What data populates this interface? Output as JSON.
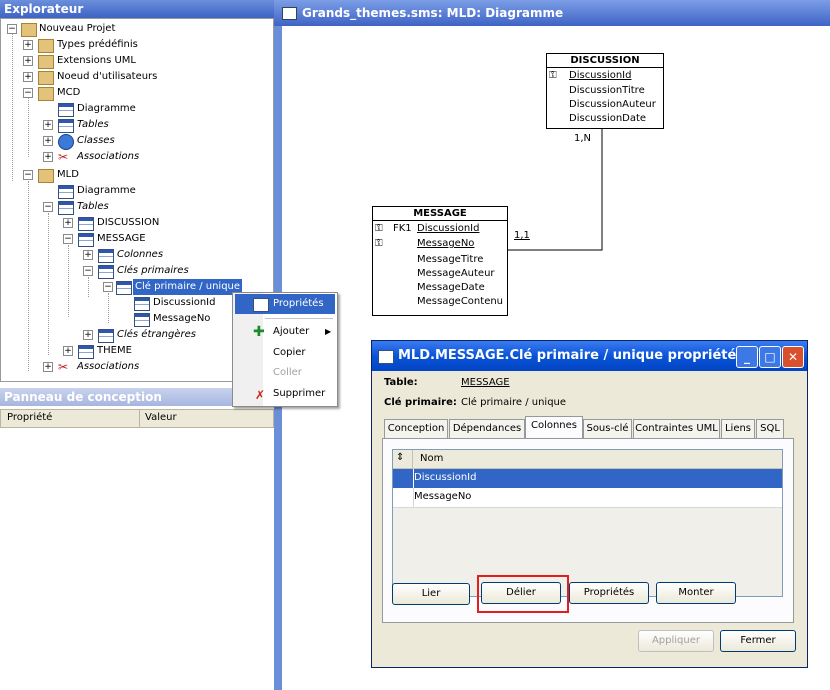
{
  "explorer": {
    "title": "Explorateur",
    "tree": [
      {
        "label": "Nouveau Projet",
        "icon": "project-icon"
      },
      {
        "label": "Types prédéfinis",
        "icon": "types-folder-icon"
      },
      {
        "label": "Extensions UML",
        "icon": "uml-extensions-icon"
      },
      {
        "label": "Noeud d'utilisateurs",
        "icon": "user-node-icon"
      },
      {
        "label": "MCD",
        "icon": "mcd-folder-icon"
      },
      {
        "label": "Diagramme",
        "icon": "diagram-icon"
      },
      {
        "label": "Tables",
        "icon": "tables-icon"
      },
      {
        "label": "Classes",
        "icon": "classes-icon"
      },
      {
        "label": "Associations",
        "icon": "associations-icon"
      },
      {
        "label": "MLD",
        "icon": "mld-folder-icon"
      },
      {
        "label": "Diagramme",
        "icon": "diagram-icon"
      },
      {
        "label": "Tables",
        "icon": "tables-icon"
      },
      {
        "label": "DISCUSSION",
        "icon": "table-icon"
      },
      {
        "label": "MESSAGE",
        "icon": "table-icon"
      },
      {
        "label": "Colonnes",
        "icon": "columns-icon"
      },
      {
        "label": "Clés primaires",
        "icon": "primary-keys-icon"
      },
      {
        "label": "Clé primaire / unique",
        "icon": "primary-key-icon"
      },
      {
        "label": "DiscussionId",
        "icon": "column-icon"
      },
      {
        "label": "MessageNo",
        "icon": "column-icon"
      },
      {
        "label": "Clés étrangères",
        "icon": "foreign-keys-icon"
      },
      {
        "label": "THEME",
        "icon": "table-icon"
      },
      {
        "label": "Associations",
        "icon": "associations-icon"
      }
    ]
  },
  "panneau": {
    "title": "Panneau de conception",
    "col_property": "Propriété",
    "col_value": "Valeur"
  },
  "context_menu": {
    "items": [
      {
        "label": "Propriétés",
        "icon": "properties-icon"
      },
      {
        "label": "Ajouter",
        "icon": "add-icon"
      },
      {
        "label": "Copier",
        "icon": ""
      },
      {
        "label": "Coller",
        "icon": ""
      },
      {
        "label": "Supprimer",
        "icon": "delete-icon"
      }
    ]
  },
  "diagram": {
    "title": "Grands_themes.sms: MLD: Diagramme",
    "discussion": {
      "name": "DISCUSSION",
      "attrs": [
        "DiscussionId",
        "DiscussionTitre",
        "DiscussionAuteur",
        "DiscussionDate"
      ]
    },
    "message": {
      "name": "MESSAGE",
      "fk": "FK1",
      "attrs": [
        "DiscussionId",
        "MessageNo",
        "MessageTitre",
        "MessageAuteur",
        "MessageDate",
        "MessageContenu"
      ]
    },
    "card_top": "1,N",
    "card_bottom": "1,1"
  },
  "dialog": {
    "title": "MLD.MESSAGE.Clé primaire / unique propriétés",
    "table_label": "Table:",
    "table_value": "MESSAGE",
    "pk_label": "Clé primaire:",
    "pk_value": "Clé primaire / unique",
    "tabs": [
      "Conception",
      "Dépendances",
      "Colonnes",
      "Sous-clé",
      "Contraintes UML",
      "Liens",
      "SQL"
    ],
    "col_header": "Nom",
    "rows": [
      "DiscussionId",
      "MessageNo"
    ],
    "buttons": {
      "lier": "Lier",
      "delier": "Délier",
      "proprietes": "Propriétés",
      "monter": "Monter",
      "appliquer": "Appliquer",
      "fermer": "Fermer"
    },
    "colors": {
      "highlight": "#e02020",
      "selection": "#3166c6"
    }
  }
}
